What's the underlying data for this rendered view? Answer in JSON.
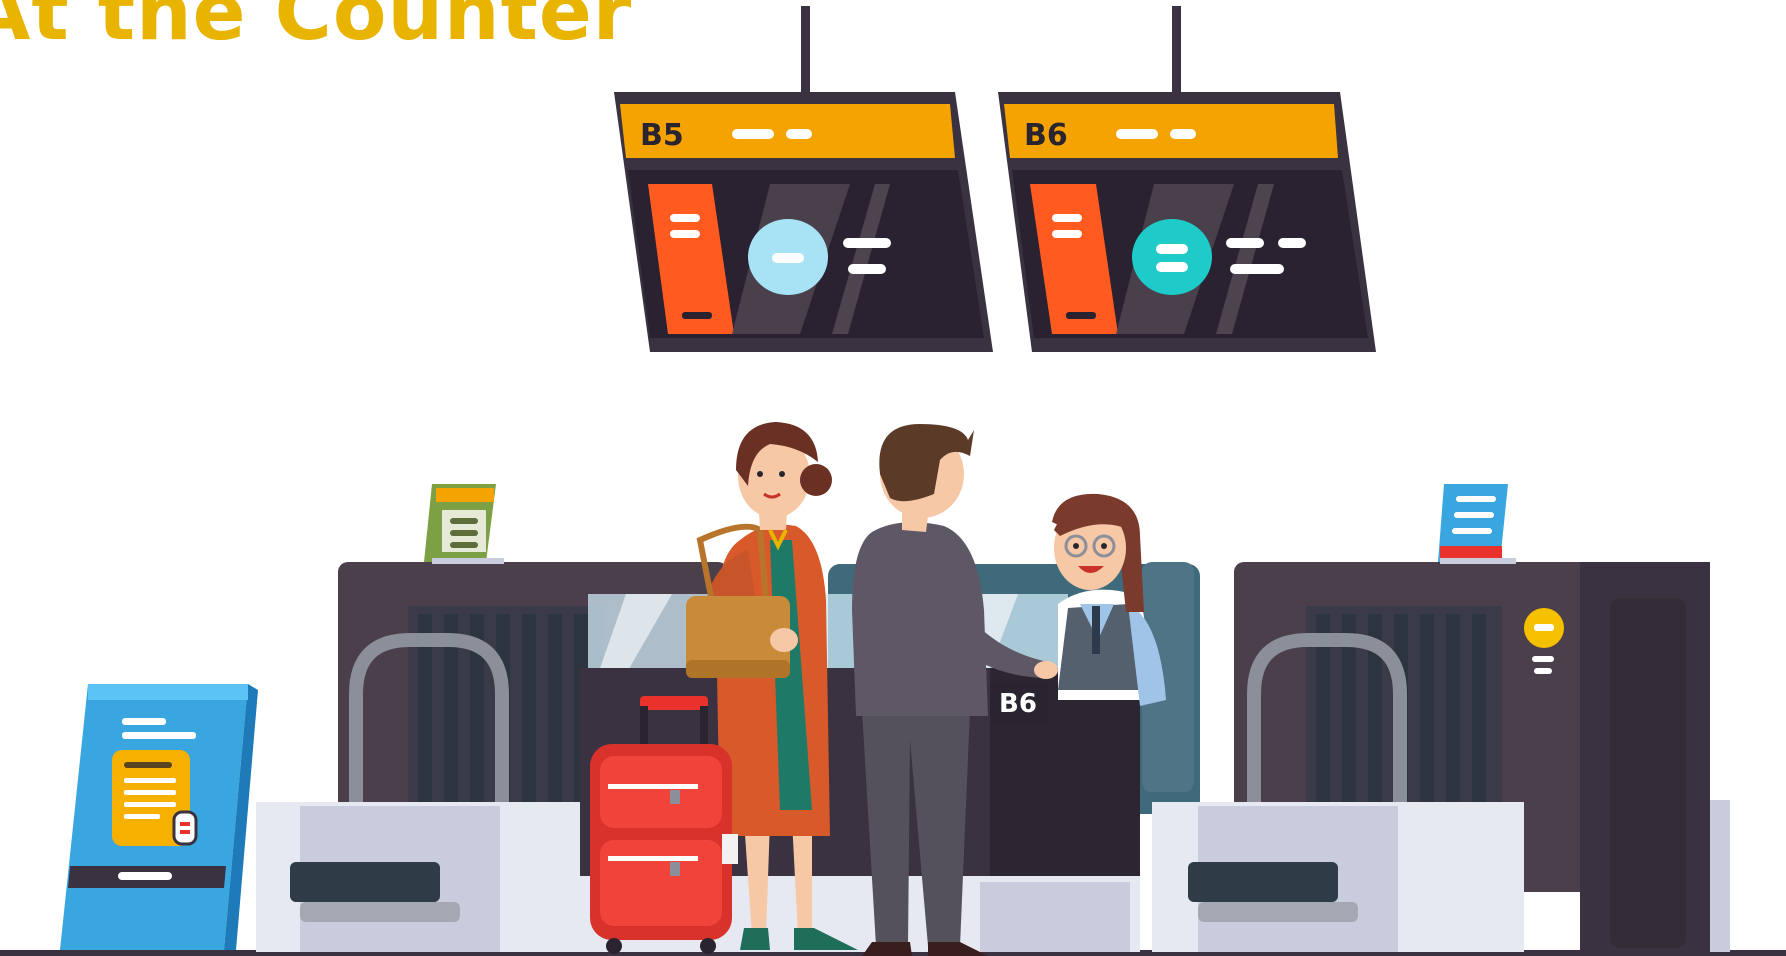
{
  "page": {
    "title": "At the Counter"
  },
  "scene": {
    "screens": [
      {
        "gate": "B5"
      },
      {
        "gate": "B6"
      }
    ],
    "desk_sign": "B6"
  },
  "colors": {
    "title": "#e8b400",
    "screen_header": "#f5a300",
    "screen_body": "#2e2630",
    "screen_panel": "#ff5a1f",
    "counter": "#4a3f4a",
    "conveyor": "#c8ccdc",
    "suitcase": "#e8322b",
    "kiosk": "#3aa6e0"
  },
  "icons": [
    "departure-board-icon",
    "suitcase-icon",
    "check-in-desk-icon",
    "info-standee-icon"
  ]
}
